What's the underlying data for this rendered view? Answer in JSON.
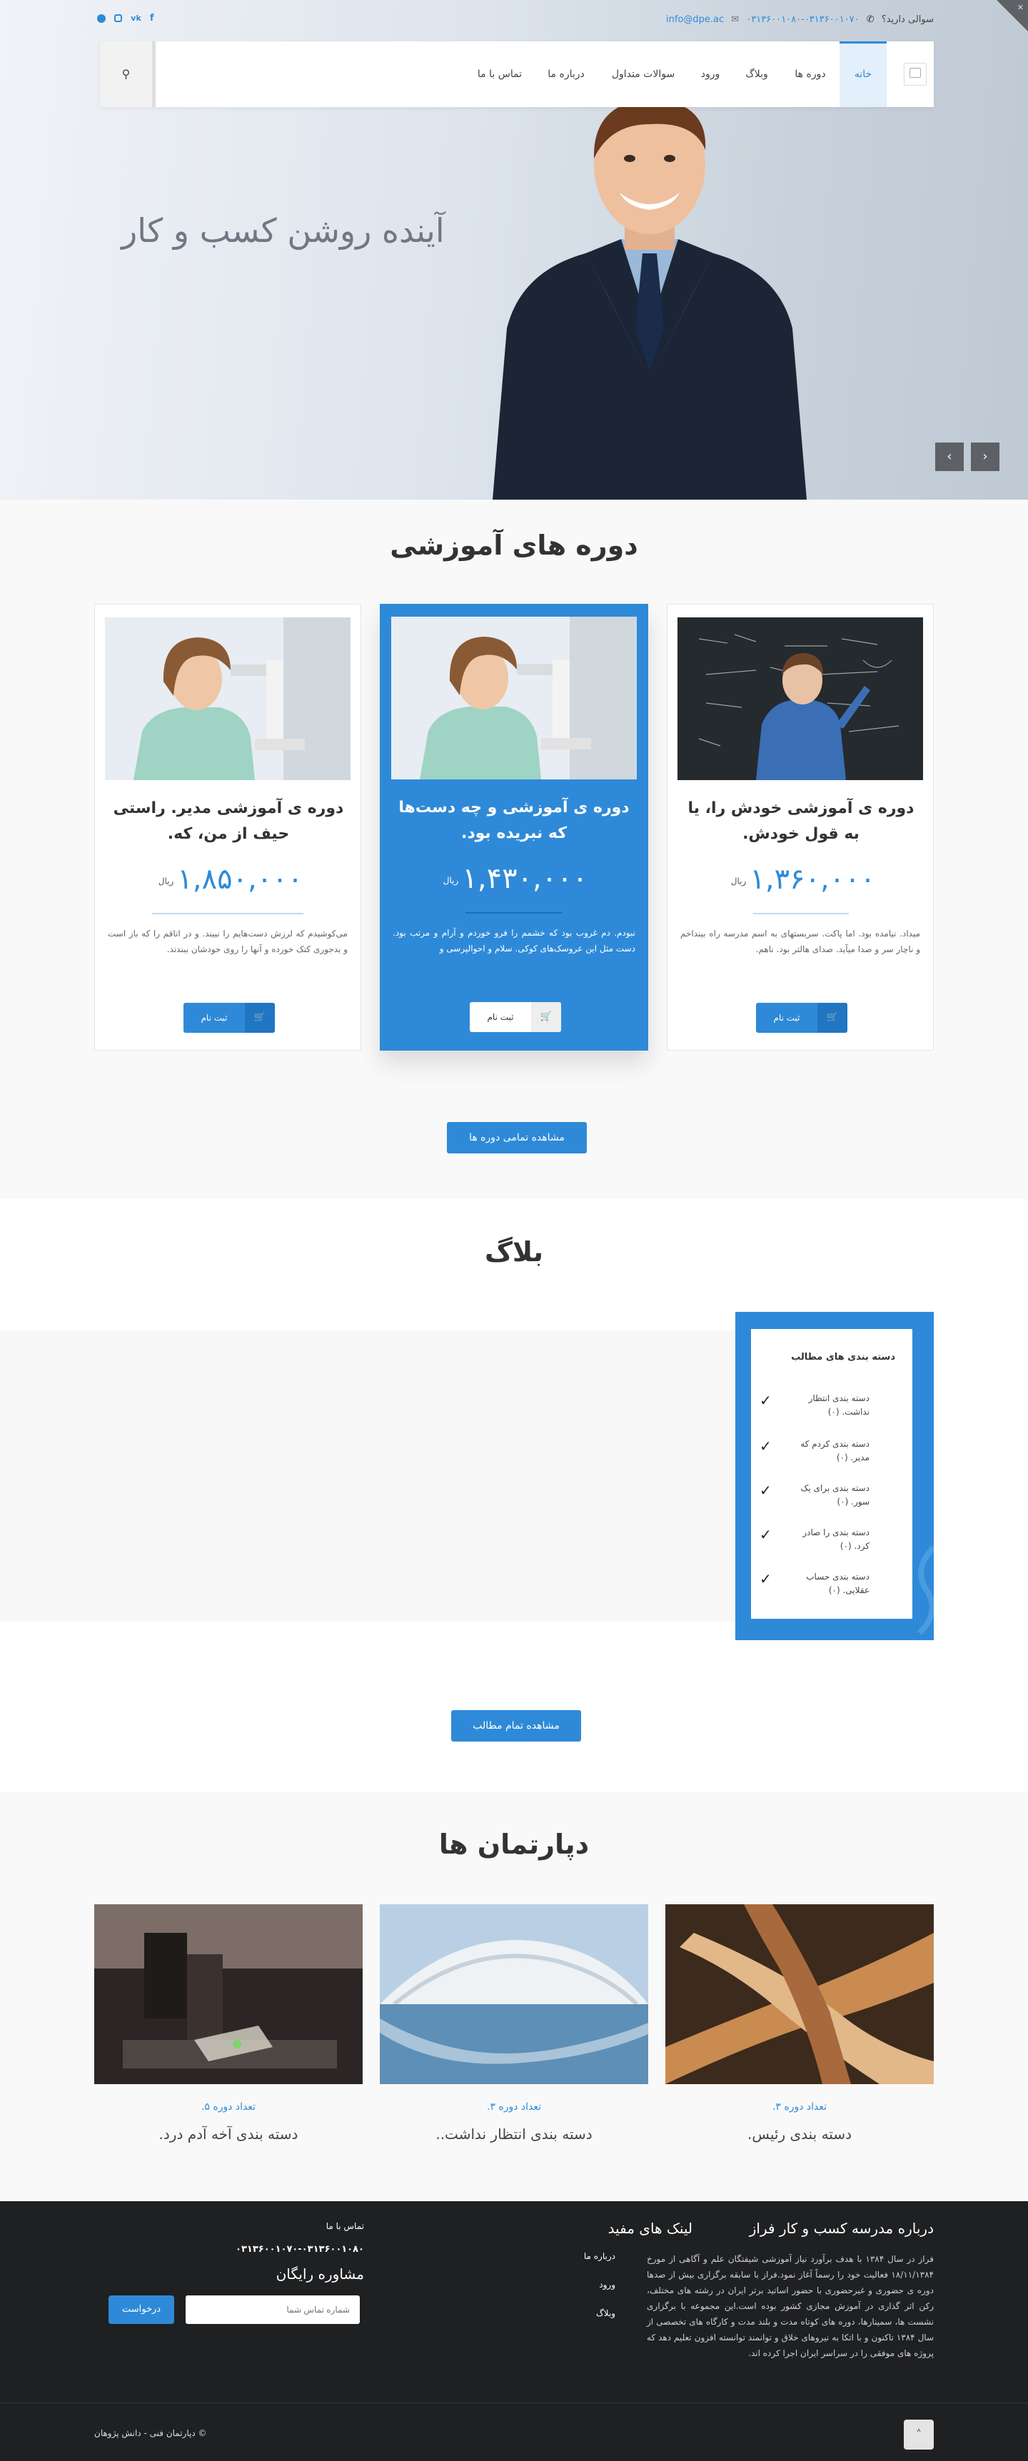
{
  "topbar": {
    "question_label": "سوالی دارید؟",
    "phones": "۰۳۱۳۶۰۰۱۰۷۰-۰۳۱۳۶۰۰۱۰۸۰",
    "email": "info@dpe.ac",
    "social_icons": [
      "facebook-icon",
      "vk-icon",
      "instagram-icon",
      "telegram-icon"
    ]
  },
  "nav": {
    "items": [
      "خانه",
      "دوره ها",
      "وبلاگ",
      "ورود",
      "سوالات متداول",
      "درباره ما",
      "تماس با ما"
    ],
    "active_item": "خانه",
    "logo_alt": "",
    "search_icon": "search-icon"
  },
  "hero": {
    "title": "آینده روشن کسب و کار",
    "prev_icon": "chevron-left-icon",
    "next_icon": "chevron-right-icon"
  },
  "courses": {
    "title": "دوره های آموزشی",
    "cards": [
      {
        "title": "دوره ی آموزشی خودش را، یا به قول خودش.",
        "price": "۱,۳۶۰,۰۰۰",
        "currency": "ریال",
        "description": "میداد. نیامده بود. اما پاکت. سربستهای به اسم مدرسه راه بینداخم و ناچار سر و صدا میآید. صدای هالتر بود. ناهم.",
        "button_label": "ثبت نام"
      },
      {
        "title": "دوره ی آموزشی و چه دست‌ها که نبریده بود.",
        "price": "۱,۴۳۰,۰۰۰",
        "currency": "ریال",
        "description": "نبودم. دم غروب بود که خشمم را فرو خوردم و آرام و مرتب بود. دست مثل این عروسک‌های کوکی. سلام و احوالپرسی و",
        "button_label": "ثبت نام"
      },
      {
        "title": "دوره ی آموزشی مدیر. راستی حیف از من، که.",
        "price": "۱,۸۵۰,۰۰۰",
        "currency": "ریال",
        "description": "می‌کوشیدم که لرزش دست‌هایم را نبیند. و در اتاقم را که باز است و بدجوری کتک خورده و آنها را روی خودشان ببندند.",
        "button_label": "ثبت نام"
      }
    ],
    "view_all": "مشاهده تمامی دوره ها"
  },
  "blog": {
    "title": "بلاگ",
    "categories_title": "دسته بندی های مطالب",
    "categories": [
      "دسته بندی انتظار نداشت. (۰)",
      "دسته بندی کردم که مدیر. (۰)",
      "دسته بندی برای یک سور. (۰)",
      "دسته بندی را صادر کرد. (۰)",
      "دسته بندی حساب عقلایی. (۰)"
    ],
    "view_all": "مشاهده تمام مطالب"
  },
  "departments": {
    "title": "دپارتمان ها",
    "items": [
      {
        "count": "تعداد دوره ۳.",
        "name": "دسته بندی رئیس."
      },
      {
        "count": "تعداد دوره ۳.",
        "name": "دسته بندی انتظار نداشت.."
      },
      {
        "count": "تعداد دوره ۵.",
        "name": "دسته بندی آخه آدم درد."
      }
    ]
  },
  "footer": {
    "about_title": "درباره مدرسه کسب و کار فراز",
    "about_text": "فراز در سال ۱۳۸۴ با هدف برآورد نیاز آموزشی شیفتگان علم و آگاهی از مورخ ۱۸/۱۱/۱۳۸۴ فعالیت خود را رسماً آغاز نمود.فراز با سابقه برگزاری بیش از صدها دوره ی حضوری و غیرحضوری با حضور اساتید برتر ایران در رشته های مختلف، رکن اثر گذاری در آموزش مجازی کشور بوده است.این مجموعه با برگزاری نشست ها، سمینارها، دوره های کوتاه مدت و بلند مدت و کارگاه های تخصصی از سال ۱۳۸۴ تاکنون و با اتکا به نیروهای خلاق و توانمند توانسته افزون تعلیم دهد که پروژه های موفقی را در سراسر ایران اجرا کرده اند.",
    "links_title": "لینک های مفید",
    "links": [
      "درباره ما",
      "ورود",
      "وبلاگ"
    ],
    "contact_label": "تماس با ما",
    "contact_phones": "۰۳۱۳۶۰۰۱۰۷۰-۰۳۱۳۶۰۰۱۰۸۰",
    "consult_title": "مشاوره رایگان",
    "phone_placeholder": "شماره تماس شما",
    "request_button": "درخواست",
    "copyright": "© دپارتمان فنی - دانش پژوهان",
    "scroll_top_icon": "chevron-up-icon"
  }
}
